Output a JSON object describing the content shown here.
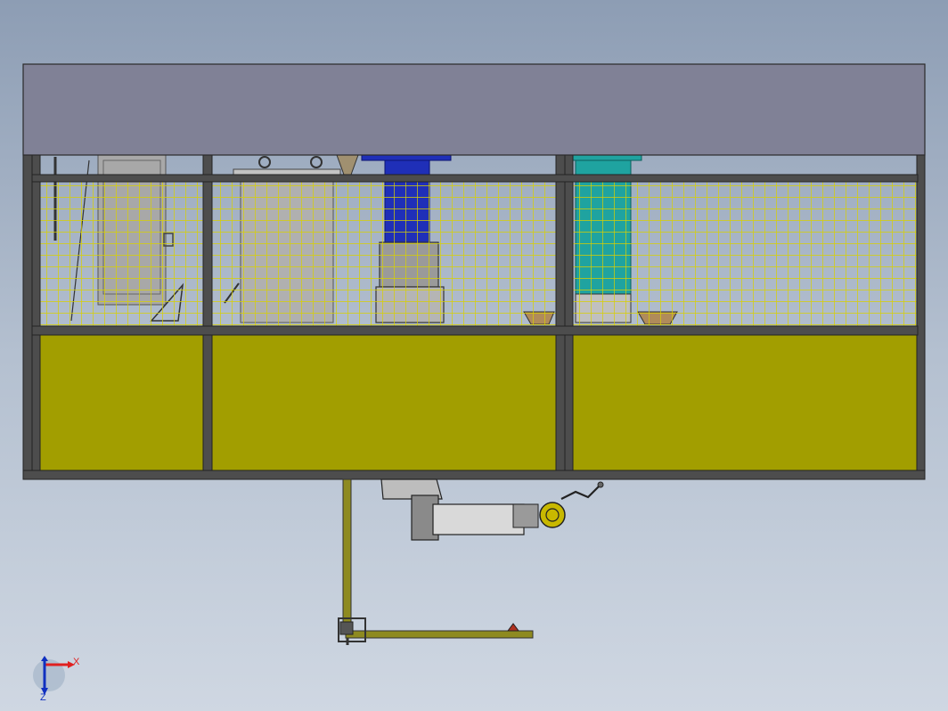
{
  "viewport": {
    "background_top": "#8d9db4",
    "background_bottom": "#cfd7e2"
  },
  "colors": {
    "roof": "#808196",
    "frame": "#4d4d4d",
    "panel": "#a29e00",
    "mesh": "#d8d000",
    "blue_column": "#1f2fb8",
    "teal_column": "#1fa3a0",
    "gray_tank": "#b0b0b0",
    "robot_body": "#d9d9d9",
    "robot_joint": "#c8b800",
    "track": "#8e8a20",
    "axis_x": "#e02020",
    "axis_y": "#1030c0",
    "axis_z": "#108020"
  },
  "axis_triad": {
    "x_label": "X",
    "z_label": "Z"
  }
}
